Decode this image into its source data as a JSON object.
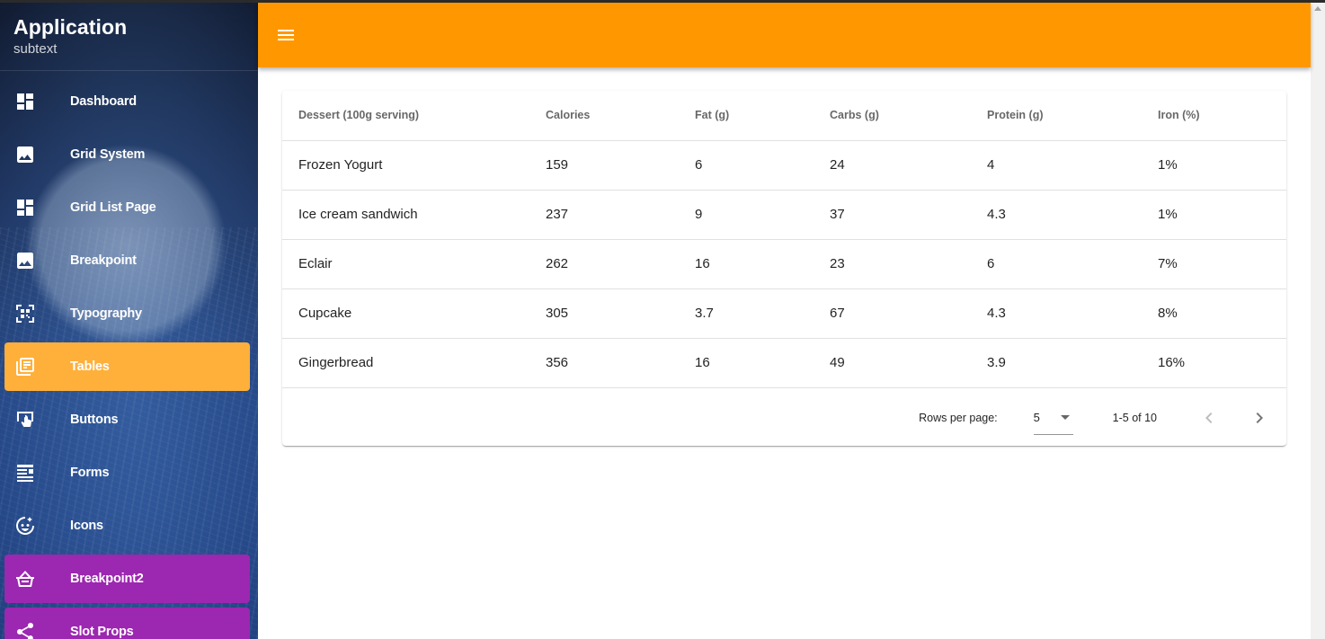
{
  "app": {
    "title": "Application",
    "subtitle": "subtext"
  },
  "sidebar": {
    "items": [
      {
        "label": "Dashboard",
        "icon": "dashboard-icon",
        "state": "normal"
      },
      {
        "label": "Grid System",
        "icon": "image-icon",
        "state": "normal"
      },
      {
        "label": "Grid List Page",
        "icon": "dashboard-icon",
        "state": "normal"
      },
      {
        "label": "Breakpoint",
        "icon": "image-icon",
        "state": "normal"
      },
      {
        "label": "Typography",
        "icon": "qr-scanner-icon",
        "state": "normal"
      },
      {
        "label": "Tables",
        "icon": "library-books-icon",
        "state": "active"
      },
      {
        "label": "Buttons",
        "icon": "touch-app-icon",
        "state": "normal"
      },
      {
        "label": "Forms",
        "icon": "forms-icon",
        "state": "normal"
      },
      {
        "label": "Icons",
        "icon": "emoji-icon",
        "state": "normal"
      },
      {
        "label": "Breakpoint2",
        "icon": "basket-icon",
        "state": "highlighted"
      },
      {
        "label": "Slot Props",
        "icon": "share-icon",
        "state": "highlighted"
      }
    ]
  },
  "colors": {
    "appbar": "#ff9800",
    "active_item": "#ffb03b",
    "highlighted_item": "#9c27b0"
  },
  "table": {
    "headers": [
      "Dessert (100g serving)",
      "Calories",
      "Fat (g)",
      "Carbs (g)",
      "Protein (g)",
      "Iron (%)"
    ],
    "rows": [
      [
        "Frozen Yogurt",
        "159",
        "6",
        "24",
        "4",
        "1%"
      ],
      [
        "Ice cream sandwich",
        "237",
        "9",
        "37",
        "4.3",
        "1%"
      ],
      [
        "Eclair",
        "262",
        "16",
        "23",
        "6",
        "7%"
      ],
      [
        "Cupcake",
        "305",
        "3.7",
        "67",
        "4.3",
        "8%"
      ],
      [
        "Gingerbread",
        "356",
        "16",
        "49",
        "3.9",
        "16%"
      ]
    ],
    "footer": {
      "rows_per_page_label": "Rows per page:",
      "rows_per_page_value": "5",
      "page_range": "1-5 of 10"
    }
  }
}
